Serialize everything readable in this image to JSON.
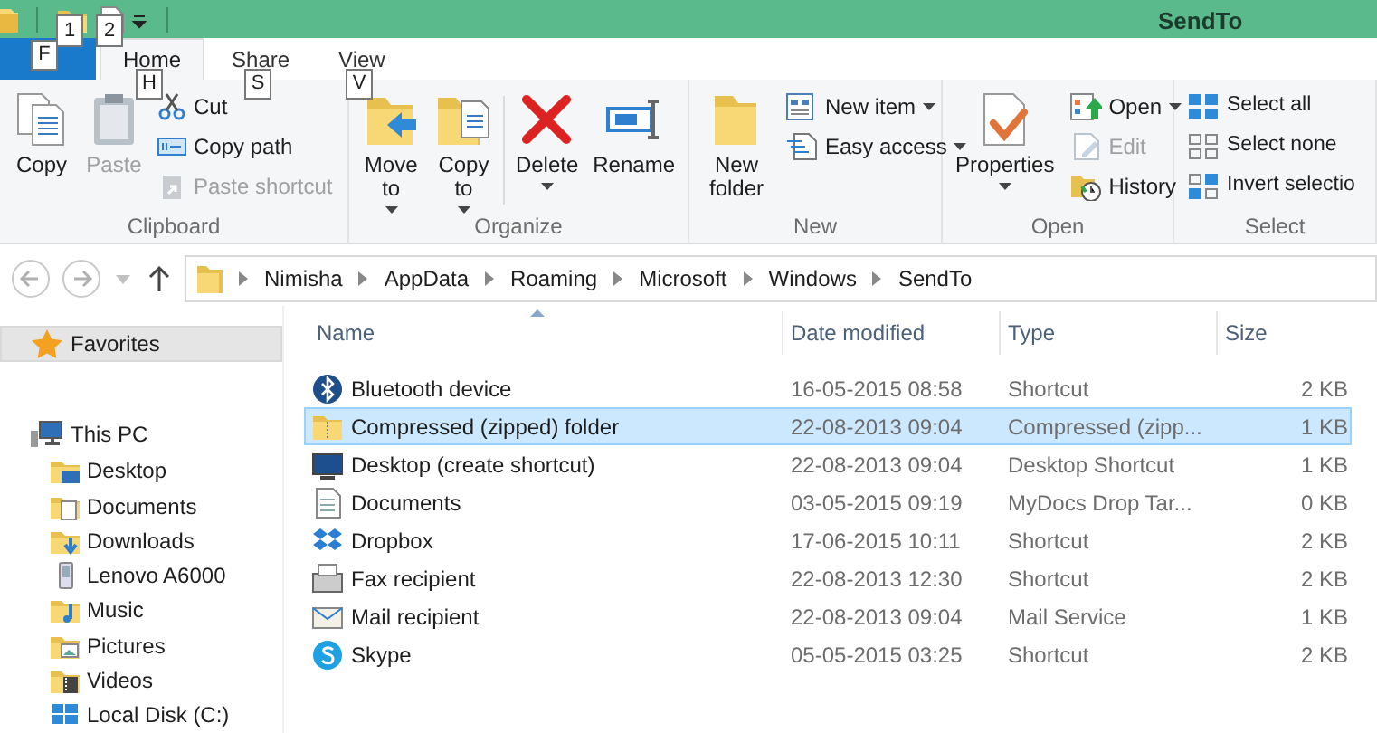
{
  "title_bar": {
    "quick_access": [
      {
        "keytip": "1"
      },
      {
        "keytip": "2"
      }
    ],
    "title": "SendTo"
  },
  "ribbon_tabs": [
    {
      "kind": "file",
      "keytip": "F",
      "selected": false
    },
    {
      "kind": "tab",
      "label": "Home",
      "keytip": "H",
      "selected": true
    },
    {
      "kind": "tab",
      "label": "Share",
      "keytip": "S",
      "selected": false
    },
    {
      "kind": "tab",
      "label": "View",
      "keytip": "V",
      "selected": false
    }
  ],
  "ribbon_groups": [
    {
      "label": "Clipboard",
      "commands": [
        {
          "kind": "large",
          "label": "Copy",
          "disabled": false,
          "dropdown": false
        },
        {
          "kind": "large",
          "label": "Paste",
          "disabled": true,
          "dropdown": false
        },
        {
          "kind": "small",
          "label": "Cut",
          "disabled": false,
          "dropdown": false
        },
        {
          "kind": "small",
          "label": "Copy path",
          "disabled": false,
          "dropdown": false
        },
        {
          "kind": "small",
          "label": "Paste shortcut",
          "disabled": true,
          "dropdown": false
        }
      ]
    },
    {
      "label": "Organize",
      "commands": [
        {
          "kind": "large",
          "label": "Move to",
          "disabled": false,
          "dropdown": true
        },
        {
          "kind": "large",
          "label": "Copy to",
          "disabled": false,
          "dropdown": true
        },
        {
          "kind": "divider"
        },
        {
          "kind": "large",
          "label": "Delete",
          "disabled": false,
          "dropdown": true
        },
        {
          "kind": "large",
          "label": "Rename",
          "disabled": false,
          "dropdown": false
        }
      ]
    },
    {
      "label": "New",
      "commands": [
        {
          "kind": "large",
          "label": "New folder",
          "disabled": false,
          "dropdown": false
        },
        {
          "kind": "small",
          "label": "New item",
          "disabled": false,
          "dropdown": true
        },
        {
          "kind": "small",
          "label": "Easy access",
          "disabled": false,
          "dropdown": true
        }
      ]
    },
    {
      "label": "Open",
      "commands": [
        {
          "kind": "large",
          "label": "Properties",
          "disabled": false,
          "dropdown": true
        },
        {
          "kind": "small",
          "label": "Open",
          "disabled": false,
          "dropdown": true
        },
        {
          "kind": "small",
          "label": "Edit",
          "disabled": true,
          "dropdown": false
        },
        {
          "kind": "small",
          "label": "History",
          "disabled": false,
          "dropdown": false
        }
      ]
    },
    {
      "label": "Select",
      "commands": [
        {
          "kind": "small",
          "label": "Select all",
          "disabled": false,
          "dropdown": false
        },
        {
          "kind": "small",
          "label": "Select none",
          "disabled": false,
          "dropdown": false
        },
        {
          "kind": "small",
          "label": "Invert selectio",
          "disabled": false,
          "dropdown": false
        }
      ]
    }
  ],
  "address_bar": {
    "path": [
      "Nimisha",
      "AppData",
      "Roaming",
      "Microsoft",
      "Windows",
      "SendTo"
    ]
  },
  "navigation": [
    {
      "label": "Favorites",
      "selected": true
    },
    {
      "label": "This PC",
      "selected": false,
      "children": [
        {
          "label": "Desktop",
          "selected": false
        },
        {
          "label": "Documents",
          "selected": false
        },
        {
          "label": "Downloads",
          "selected": false
        },
        {
          "label": "Lenovo A6000",
          "selected": false
        },
        {
          "label": "Music",
          "selected": false
        },
        {
          "label": "Pictures",
          "selected": false
        },
        {
          "label": "Videos",
          "selected": false
        },
        {
          "label": "Local Disk (C:)",
          "selected": false
        }
      ]
    }
  ],
  "file_list": {
    "columns": [
      "Name",
      "Date modified",
      "Type",
      "Size"
    ],
    "rows": [
      {
        "name": "Bluetooth device",
        "date_modified": "16-05-2015 08:58",
        "type": "Shortcut",
        "size": "2 KB",
        "selected": false
      },
      {
        "name": "Compressed (zipped) folder",
        "date_modified": "22-08-2013 09:04",
        "type": "Compressed (zipp...",
        "size": "1 KB",
        "selected": true
      },
      {
        "name": "Desktop (create shortcut)",
        "date_modified": "22-08-2013 09:04",
        "type": "Desktop Shortcut",
        "size": "1 KB",
        "selected": false
      },
      {
        "name": "Documents",
        "date_modified": "03-05-2015 09:19",
        "type": "MyDocs Drop Tar...",
        "size": "0 KB",
        "selected": false
      },
      {
        "name": "Dropbox",
        "date_modified": "17-06-2015 10:11",
        "type": "Shortcut",
        "size": "2 KB",
        "selected": false
      },
      {
        "name": "Fax recipient",
        "date_modified": "22-08-2013 12:30",
        "type": "Shortcut",
        "size": "2 KB",
        "selected": false
      },
      {
        "name": "Mail recipient",
        "date_modified": "22-08-2013 09:04",
        "type": "Mail Service",
        "size": "1 KB",
        "selected": false
      },
      {
        "name": "Skype",
        "date_modified": "05-05-2015 03:25",
        "type": "Shortcut",
        "size": "2 KB",
        "selected": false
      }
    ]
  }
}
